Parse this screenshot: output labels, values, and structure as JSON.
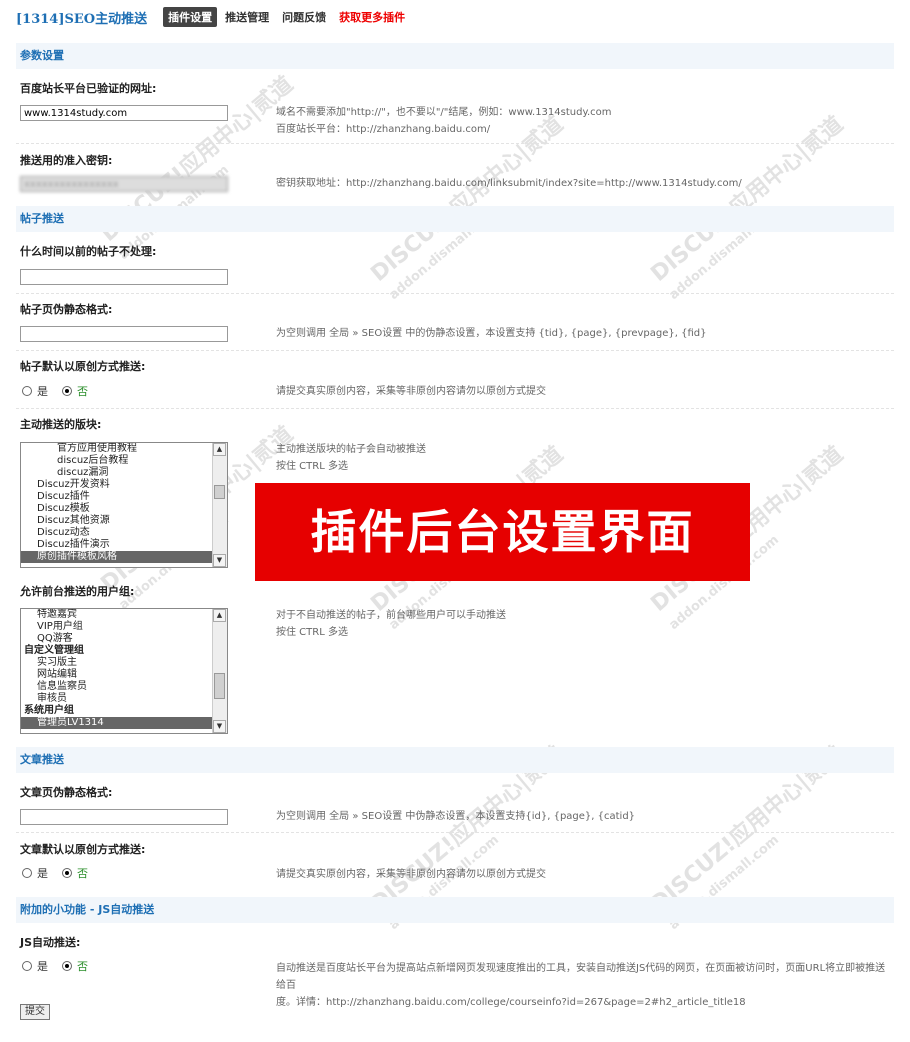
{
  "header": {
    "title": "[1314]SEO主动推送",
    "tabs": [
      "插件设置",
      "推送管理",
      "问题反馈",
      "获取更多插件"
    ]
  },
  "sections": {
    "params": "参数设置",
    "thread": "帖子推送",
    "article": "文章推送",
    "extra": "附加的小功能 - JS自动推送"
  },
  "fields": {
    "site_url": {
      "label": "百度站长平台已验证的网址:",
      "value": "www.1314study.com",
      "hint1": "域名不需要添加\"http://\"，也不要以\"/\"结尾，例如：www.1314study.com",
      "hint2": "百度站长平台：http://zhanzhang.baidu.com/"
    },
    "token": {
      "label": "推送用的准入密钥:",
      "value": "xxxxxxxxxxxxxxxx",
      "hint": "密钥获取地址：http://zhanzhang.baidu.com/linksubmit/index?site=http://www.1314study.com/"
    },
    "thread_time": {
      "label": "什么时间以前的帖子不处理:"
    },
    "thread_rewrite": {
      "label": "帖子页伪静态格式:",
      "hint": "为空则调用 全局 » SEO设置 中的伪静态设置，本设置支持 {tid}, {page}, {prevpage}, {fid}"
    },
    "thread_original": {
      "label": "帖子默认以原创方式推送:",
      "yes": "是",
      "no": "否",
      "hint": "请提交真实原创内容，采集等非原创内容请勿以原创方式提交"
    },
    "forums": {
      "label": "主动推送的版块:",
      "hint1": "主动推送版块的帖子会自动被推送",
      "hint2": "按住 CTRL 多选",
      "options": [
        {
          "text": "官方应用使用教程",
          "level": 2,
          "selected": false
        },
        {
          "text": "discuz后台教程",
          "level": 2,
          "selected": false
        },
        {
          "text": "discuz漏洞",
          "level": 2,
          "selected": false
        },
        {
          "text": "Discuz开发资料",
          "level": 1,
          "selected": false
        },
        {
          "text": "Discuz插件",
          "level": 1,
          "selected": false
        },
        {
          "text": "Discuz模板",
          "level": 1,
          "selected": false
        },
        {
          "text": "Discuz其他资源",
          "level": 1,
          "selected": false
        },
        {
          "text": "Discuz动态",
          "level": 1,
          "selected": false
        },
        {
          "text": "Discuz插件演示",
          "level": 1,
          "selected": false
        },
        {
          "text": "原创插件模板风格",
          "level": 1,
          "selected": true
        }
      ]
    },
    "groups": {
      "label": "允许前台推送的用户组:",
      "hint1": "对于不自动推送的帖子，前台哪些用户可以手动推送",
      "hint2": "按住 CTRL 多选",
      "options": [
        {
          "text": "特邀嘉宾",
          "level": 1,
          "selected": false
        },
        {
          "text": "VIP用户组",
          "level": 1,
          "selected": false
        },
        {
          "text": "QQ游客",
          "level": 1,
          "selected": false
        },
        {
          "text": "自定义管理组",
          "level": 0,
          "selected": false
        },
        {
          "text": "实习版主",
          "level": 1,
          "selected": false
        },
        {
          "text": "网站编辑",
          "level": 1,
          "selected": false
        },
        {
          "text": "信息监察员",
          "level": 1,
          "selected": false
        },
        {
          "text": "审核员",
          "level": 1,
          "selected": false
        },
        {
          "text": "系统用户组",
          "level": 0,
          "selected": false
        },
        {
          "text": "管理员LV1314",
          "level": 1,
          "selected": true
        }
      ]
    },
    "article_rewrite": {
      "label": "文章页伪静态格式:",
      "hint": "为空则调用 全局 » SEO设置 中伪静态设置，本设置支持{id}, {page}, {catid}"
    },
    "article_original": {
      "label": "文章默认以原创方式推送:",
      "yes": "是",
      "no": "否",
      "hint": "请提交真实原创内容，采集等非原创内容请勿以原创方式提交"
    },
    "js_push": {
      "label": "JS自动推送:",
      "yes": "是",
      "no": "否",
      "hint1": "自动推送是百度站长平台为提高站点新增网页发现速度推出的工具，安装自动推送JS代码的网页，在页面被访问时，页面URL将立即被推送给百",
      "hint2": "度。详情：http://zhanzhang.baidu.com/college/courseinfo?id=267&page=2#h2_article_title18"
    }
  },
  "banner": "插件后台设置界面",
  "watermark": {
    "main": "DISCUZ!应用中心|贰道",
    "sub": "addon.dismall.com"
  },
  "submit_label": "提交"
}
